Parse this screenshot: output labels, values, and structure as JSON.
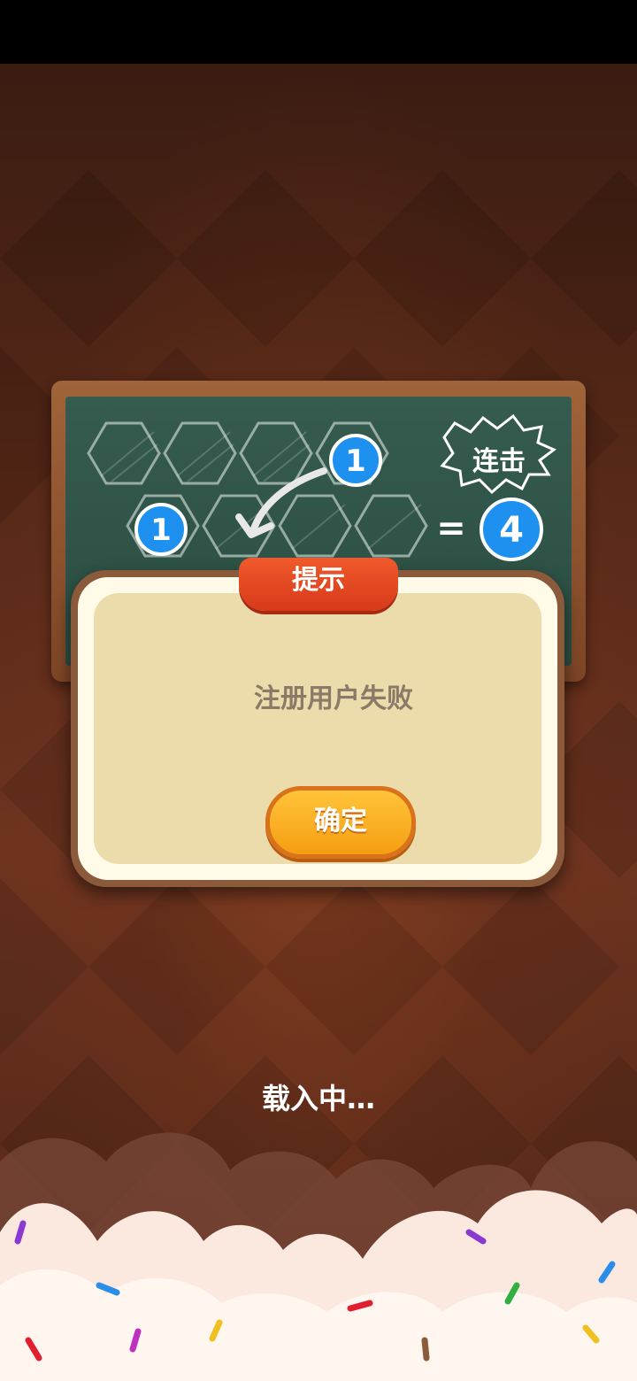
{
  "board": {
    "combo_label": "连击",
    "tile_left_number": "1",
    "tile_moving_number": "1",
    "equals_sign": "=",
    "combo_count": "4"
  },
  "dialog": {
    "title": "提示",
    "message": "注册用户失败",
    "confirm_label": "确定"
  },
  "loading_text": "载入中…",
  "colors": {
    "background": "#5a2a18",
    "chalkboard": "#2b4d41",
    "dialog_fill": "#ecdcab",
    "dialog_title_tab": "#d8391a",
    "confirm_button": "#f59e12",
    "number_bubble": "#1e90ef"
  }
}
